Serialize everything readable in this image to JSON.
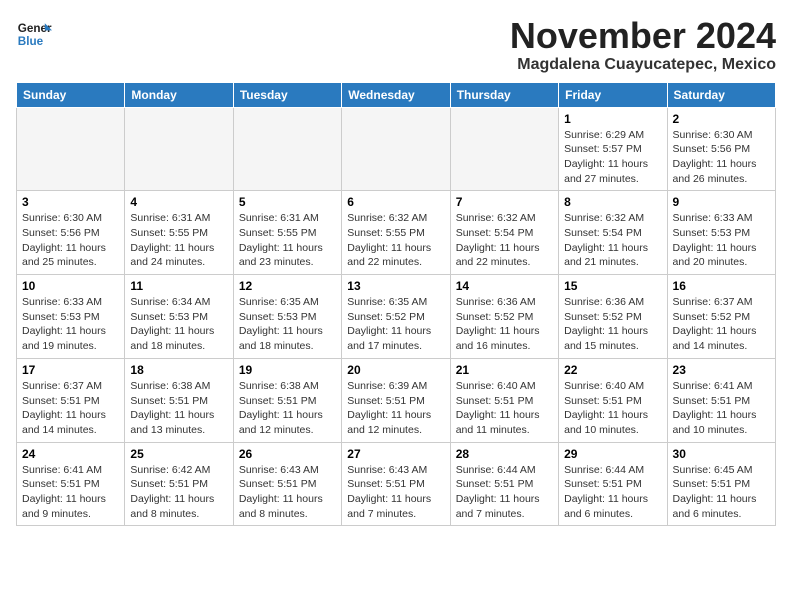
{
  "header": {
    "logo_line1": "General",
    "logo_line2": "Blue",
    "month": "November 2024",
    "location": "Magdalena Cuayucatepec, Mexico"
  },
  "weekdays": [
    "Sunday",
    "Monday",
    "Tuesday",
    "Wednesday",
    "Thursday",
    "Friday",
    "Saturday"
  ],
  "weeks": [
    [
      {
        "day": "",
        "info": ""
      },
      {
        "day": "",
        "info": ""
      },
      {
        "day": "",
        "info": ""
      },
      {
        "day": "",
        "info": ""
      },
      {
        "day": "",
        "info": ""
      },
      {
        "day": "1",
        "info": "Sunrise: 6:29 AM\nSunset: 5:57 PM\nDaylight: 11 hours and 27 minutes."
      },
      {
        "day": "2",
        "info": "Sunrise: 6:30 AM\nSunset: 5:56 PM\nDaylight: 11 hours and 26 minutes."
      }
    ],
    [
      {
        "day": "3",
        "info": "Sunrise: 6:30 AM\nSunset: 5:56 PM\nDaylight: 11 hours and 25 minutes."
      },
      {
        "day": "4",
        "info": "Sunrise: 6:31 AM\nSunset: 5:55 PM\nDaylight: 11 hours and 24 minutes."
      },
      {
        "day": "5",
        "info": "Sunrise: 6:31 AM\nSunset: 5:55 PM\nDaylight: 11 hours and 23 minutes."
      },
      {
        "day": "6",
        "info": "Sunrise: 6:32 AM\nSunset: 5:55 PM\nDaylight: 11 hours and 22 minutes."
      },
      {
        "day": "7",
        "info": "Sunrise: 6:32 AM\nSunset: 5:54 PM\nDaylight: 11 hours and 22 minutes."
      },
      {
        "day": "8",
        "info": "Sunrise: 6:32 AM\nSunset: 5:54 PM\nDaylight: 11 hours and 21 minutes."
      },
      {
        "day": "9",
        "info": "Sunrise: 6:33 AM\nSunset: 5:53 PM\nDaylight: 11 hours and 20 minutes."
      }
    ],
    [
      {
        "day": "10",
        "info": "Sunrise: 6:33 AM\nSunset: 5:53 PM\nDaylight: 11 hours and 19 minutes."
      },
      {
        "day": "11",
        "info": "Sunrise: 6:34 AM\nSunset: 5:53 PM\nDaylight: 11 hours and 18 minutes."
      },
      {
        "day": "12",
        "info": "Sunrise: 6:35 AM\nSunset: 5:53 PM\nDaylight: 11 hours and 18 minutes."
      },
      {
        "day": "13",
        "info": "Sunrise: 6:35 AM\nSunset: 5:52 PM\nDaylight: 11 hours and 17 minutes."
      },
      {
        "day": "14",
        "info": "Sunrise: 6:36 AM\nSunset: 5:52 PM\nDaylight: 11 hours and 16 minutes."
      },
      {
        "day": "15",
        "info": "Sunrise: 6:36 AM\nSunset: 5:52 PM\nDaylight: 11 hours and 15 minutes."
      },
      {
        "day": "16",
        "info": "Sunrise: 6:37 AM\nSunset: 5:52 PM\nDaylight: 11 hours and 14 minutes."
      }
    ],
    [
      {
        "day": "17",
        "info": "Sunrise: 6:37 AM\nSunset: 5:51 PM\nDaylight: 11 hours and 14 minutes."
      },
      {
        "day": "18",
        "info": "Sunrise: 6:38 AM\nSunset: 5:51 PM\nDaylight: 11 hours and 13 minutes."
      },
      {
        "day": "19",
        "info": "Sunrise: 6:38 AM\nSunset: 5:51 PM\nDaylight: 11 hours and 12 minutes."
      },
      {
        "day": "20",
        "info": "Sunrise: 6:39 AM\nSunset: 5:51 PM\nDaylight: 11 hours and 12 minutes."
      },
      {
        "day": "21",
        "info": "Sunrise: 6:40 AM\nSunset: 5:51 PM\nDaylight: 11 hours and 11 minutes."
      },
      {
        "day": "22",
        "info": "Sunrise: 6:40 AM\nSunset: 5:51 PM\nDaylight: 11 hours and 10 minutes."
      },
      {
        "day": "23",
        "info": "Sunrise: 6:41 AM\nSunset: 5:51 PM\nDaylight: 11 hours and 10 minutes."
      }
    ],
    [
      {
        "day": "24",
        "info": "Sunrise: 6:41 AM\nSunset: 5:51 PM\nDaylight: 11 hours and 9 minutes."
      },
      {
        "day": "25",
        "info": "Sunrise: 6:42 AM\nSunset: 5:51 PM\nDaylight: 11 hours and 8 minutes."
      },
      {
        "day": "26",
        "info": "Sunrise: 6:43 AM\nSunset: 5:51 PM\nDaylight: 11 hours and 8 minutes."
      },
      {
        "day": "27",
        "info": "Sunrise: 6:43 AM\nSunset: 5:51 PM\nDaylight: 11 hours and 7 minutes."
      },
      {
        "day": "28",
        "info": "Sunrise: 6:44 AM\nSunset: 5:51 PM\nDaylight: 11 hours and 7 minutes."
      },
      {
        "day": "29",
        "info": "Sunrise: 6:44 AM\nSunset: 5:51 PM\nDaylight: 11 hours and 6 minutes."
      },
      {
        "day": "30",
        "info": "Sunrise: 6:45 AM\nSunset: 5:51 PM\nDaylight: 11 hours and 6 minutes."
      }
    ]
  ]
}
